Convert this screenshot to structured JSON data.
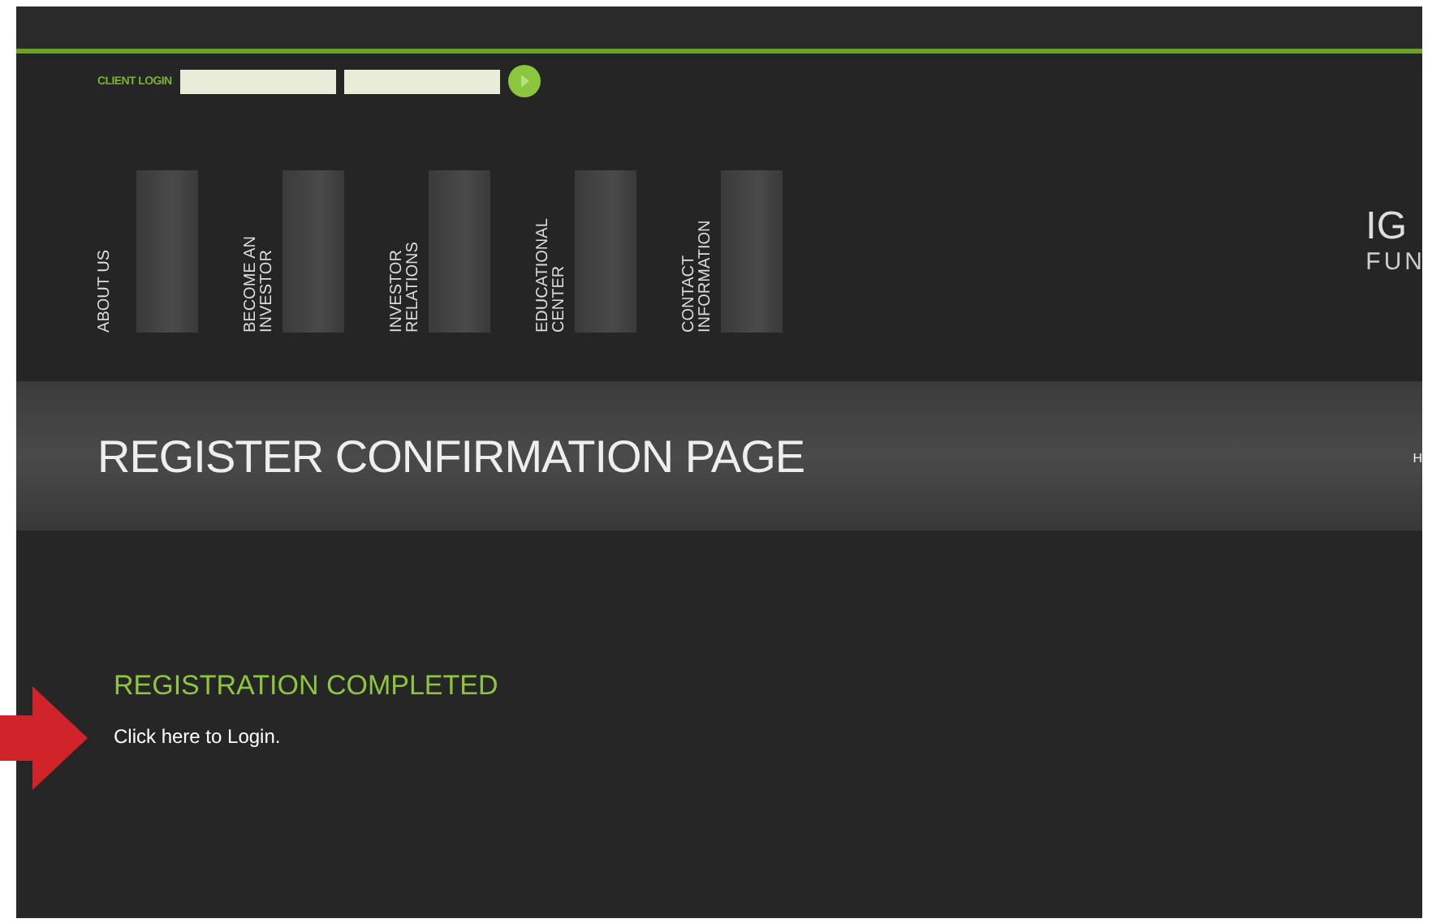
{
  "login": {
    "label": "CLIENT LOGIN"
  },
  "nav": [
    {
      "label": "ABOUT US"
    },
    {
      "label": "BECOME AN INVESTOR"
    },
    {
      "label": "INVESTOR RELATIONS"
    },
    {
      "label": "EDUCATIONAL CENTER"
    },
    {
      "label": "CONTACT INFORMATION"
    }
  ],
  "logo": {
    "line_1": "IG",
    "line_2": "FUN"
  },
  "banner": {
    "title": "REGISTER CONFIRMATION PAGE",
    "crumb": "H"
  },
  "content": {
    "heading": "REGISTRATION COMPLETED",
    "link": "Click here to Login."
  }
}
